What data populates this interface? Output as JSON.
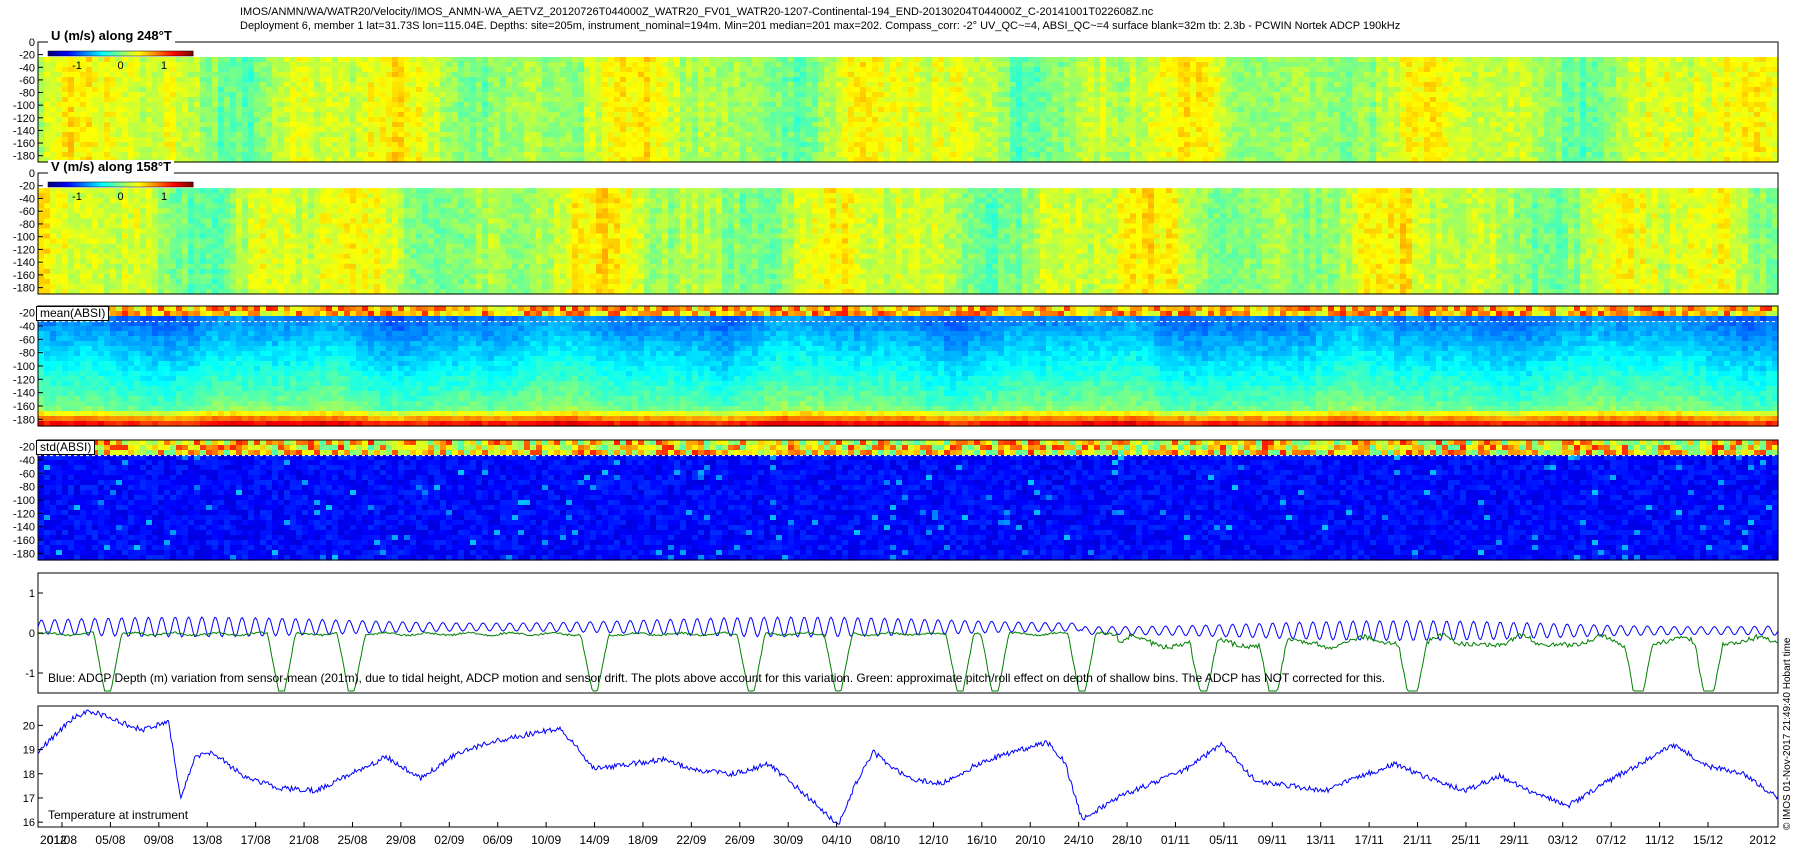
{
  "header": {
    "line1": "IMOS/ANMN/WA/WATR20/Velocity/IMOS_ANMN-WA_AETVZ_20120726T044000Z_WATR20_FV01_WATR20-1207-Continental-194_END-20130204T044000Z_C-20141001T022608Z.nc",
    "line2": "Deployment 6, member 1 lat=31.73S lon=115.04E. Depths: site=205m, instrument_nominal=194m. Min=201 median=201 max=202. Compass_corr: -2° UV_QC~=4, ABSI_QC~=4 surface blank=32m tb: 2.3b - PCWIN Nortek       ADCP 190kHz"
  },
  "panels": {
    "u": {
      "title": "U (m/s) along 248°T",
      "cbar_ticks": [
        "-1",
        "0",
        "1"
      ]
    },
    "v": {
      "title": "V (m/s) along 158°T",
      "cbar_ticks": [
        "-1",
        "0",
        "1"
      ]
    },
    "mean": {
      "title": "mean(ABSI)"
    },
    "std": {
      "title": "std(ABSI)"
    },
    "depth_line_note": "Blue: ADCP Depth (m) variation from sensor-mean (201m), due to tidal height, ADCP motion and sensor drift. The plots above account for this variation. Green: approximate pitch/roll effect on depth of shallow bins. The ADCP has NOT corrected for this.",
    "temp_note": "Temperature at instrument"
  },
  "side_note": "© IMOS 01-Nov-2017 21:49:40 Hobart time",
  "x_axis": {
    "year_left": "2012",
    "year_right": "2012",
    "ticks": [
      "01/08",
      "05/08",
      "09/08",
      "13/08",
      "17/08",
      "21/08",
      "25/08",
      "29/08",
      "02/09",
      "06/09",
      "10/09",
      "14/09",
      "18/09",
      "22/09",
      "26/09",
      "30/09",
      "04/10",
      "08/10",
      "12/10",
      "16/10",
      "20/10",
      "24/10",
      "28/10",
      "01/11",
      "05/11",
      "09/11",
      "13/11",
      "17/11",
      "21/11",
      "25/11",
      "29/11",
      "03/12",
      "07/12",
      "11/12",
      "15/12"
    ]
  },
  "colors": {
    "blue_line": "#0000ff",
    "green_line": "#008000",
    "jet_dark": "#00007f",
    "jet_blue": "#0050ff",
    "jet_green": "#3cdc3c",
    "jet_yellow": "#f0f000",
    "jet_red": "#e01000"
  },
  "chart_data": [
    {
      "type": "heatmap",
      "title": "U (m/s) along 248°T",
      "ylim": [
        -190,
        0
      ],
      "yticks": [
        0,
        -20,
        -40,
        -60,
        -80,
        -100,
        -120,
        -140,
        -160,
        -180
      ],
      "clim": [
        -1.5,
        1.5
      ]
    },
    {
      "type": "heatmap",
      "title": "V (m/s) along 158°T",
      "ylim": [
        -190,
        0
      ],
      "yticks": [
        0,
        -20,
        -40,
        -60,
        -80,
        -100,
        -120,
        -140,
        -160,
        -180
      ],
      "clim": [
        -1.5,
        1.5
      ]
    },
    {
      "type": "heatmap",
      "title": "mean(ABSI)",
      "ylim": [
        -190,
        -10
      ],
      "yticks": [
        -20,
        -40,
        -60,
        -80,
        -100,
        -120,
        -140,
        -160,
        -180
      ]
    },
    {
      "type": "heatmap",
      "title": "std(ABSI)",
      "ylim": [
        -190,
        -10
      ],
      "yticks": [
        -20,
        -40,
        -60,
        -80,
        -100,
        -120,
        -140,
        -160,
        -180
      ]
    },
    {
      "type": "line",
      "ylim": [
        -1.5,
        1.5
      ],
      "yticks": [
        1,
        0,
        -1
      ],
      "series": [
        {
          "color": "#0000ff",
          "baseline": 0.15,
          "tidal_amplitude": 0.25,
          "cycles": 130
        },
        {
          "color": "#008000",
          "baseline": 0.0,
          "spikes": [
            0.04,
            0.14,
            0.18,
            0.32,
            0.41,
            0.46,
            0.53,
            0.55,
            0.6,
            0.67,
            0.71,
            0.79,
            0.92,
            0.96
          ]
        }
      ]
    },
    {
      "type": "line",
      "ylim": [
        15.8,
        20.8
      ],
      "yticks": [
        20,
        19,
        18,
        17,
        16
      ],
      "series": [
        {
          "color": "#0000ff",
          "x": [
            0,
            0.01,
            0.02,
            0.03,
            0.045,
            0.06,
            0.075,
            0.082,
            0.09,
            0.1,
            0.12,
            0.14,
            0.16,
            0.18,
            0.2,
            0.22,
            0.24,
            0.26,
            0.28,
            0.3,
            0.32,
            0.34,
            0.36,
            0.38,
            0.4,
            0.42,
            0.44,
            0.46,
            0.47,
            0.48,
            0.5,
            0.52,
            0.54,
            0.56,
            0.58,
            0.59,
            0.6,
            0.62,
            0.64,
            0.66,
            0.68,
            0.7,
            0.72,
            0.74,
            0.76,
            0.78,
            0.8,
            0.82,
            0.84,
            0.86,
            0.88,
            0.9,
            0.92,
            0.94,
            0.96,
            0.98,
            1.0
          ],
          "y": [
            18.9,
            19.6,
            20.3,
            20.6,
            20.2,
            19.8,
            20.2,
            16.9,
            18.7,
            18.9,
            17.8,
            17.4,
            17.3,
            18.0,
            18.7,
            17.8,
            18.8,
            19.3,
            19.6,
            19.9,
            18.2,
            18.4,
            18.6,
            18.1,
            18.0,
            18.4,
            17.2,
            15.9,
            17.6,
            18.9,
            17.8,
            17.6,
            18.4,
            18.9,
            19.3,
            18.5,
            16.1,
            17.0,
            17.6,
            18.2,
            19.2,
            17.7,
            17.5,
            17.3,
            17.9,
            18.4,
            17.8,
            17.3,
            17.9,
            17.2,
            16.7,
            17.6,
            18.4,
            19.2,
            18.3,
            18.0,
            17.0
          ]
        }
      ]
    }
  ]
}
